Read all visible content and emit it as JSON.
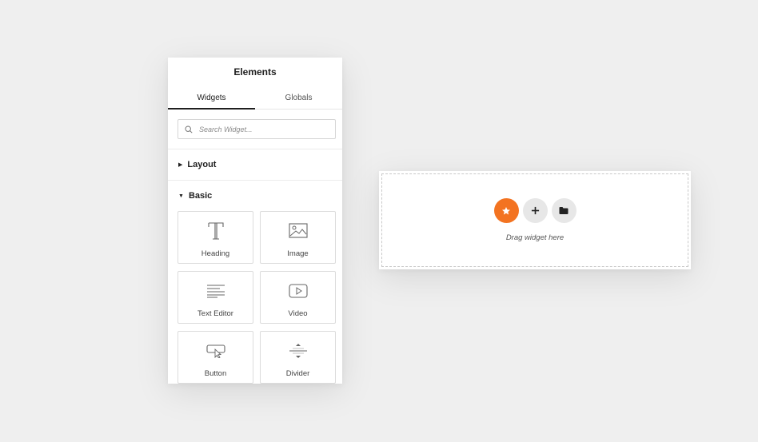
{
  "panel": {
    "title": "Elements",
    "tabs": [
      {
        "label": "Widgets",
        "active": true
      },
      {
        "label": "Globals",
        "active": false
      }
    ],
    "search": {
      "placeholder": "Search Widget..."
    },
    "sections": [
      {
        "label": "Layout",
        "expanded": false
      },
      {
        "label": "Basic",
        "expanded": true
      }
    ],
    "widgets": [
      {
        "label": "Heading",
        "icon": "heading-icon"
      },
      {
        "label": "Image",
        "icon": "image-icon"
      },
      {
        "label": "Text Editor",
        "icon": "text-editor-icon"
      },
      {
        "label": "Video",
        "icon": "video-icon"
      },
      {
        "label": "Button",
        "icon": "button-icon"
      },
      {
        "label": "Divider",
        "icon": "divider-icon"
      }
    ]
  },
  "drop_area": {
    "text": "Drag widget here",
    "buttons": [
      {
        "icon": "star-icon",
        "color": "#f37321"
      },
      {
        "icon": "plus-icon",
        "color": "#e7e7e7"
      },
      {
        "icon": "folder-icon",
        "color": "#e7e7e7"
      }
    ]
  },
  "colors": {
    "accent": "#f37321",
    "background": "#efefef"
  }
}
